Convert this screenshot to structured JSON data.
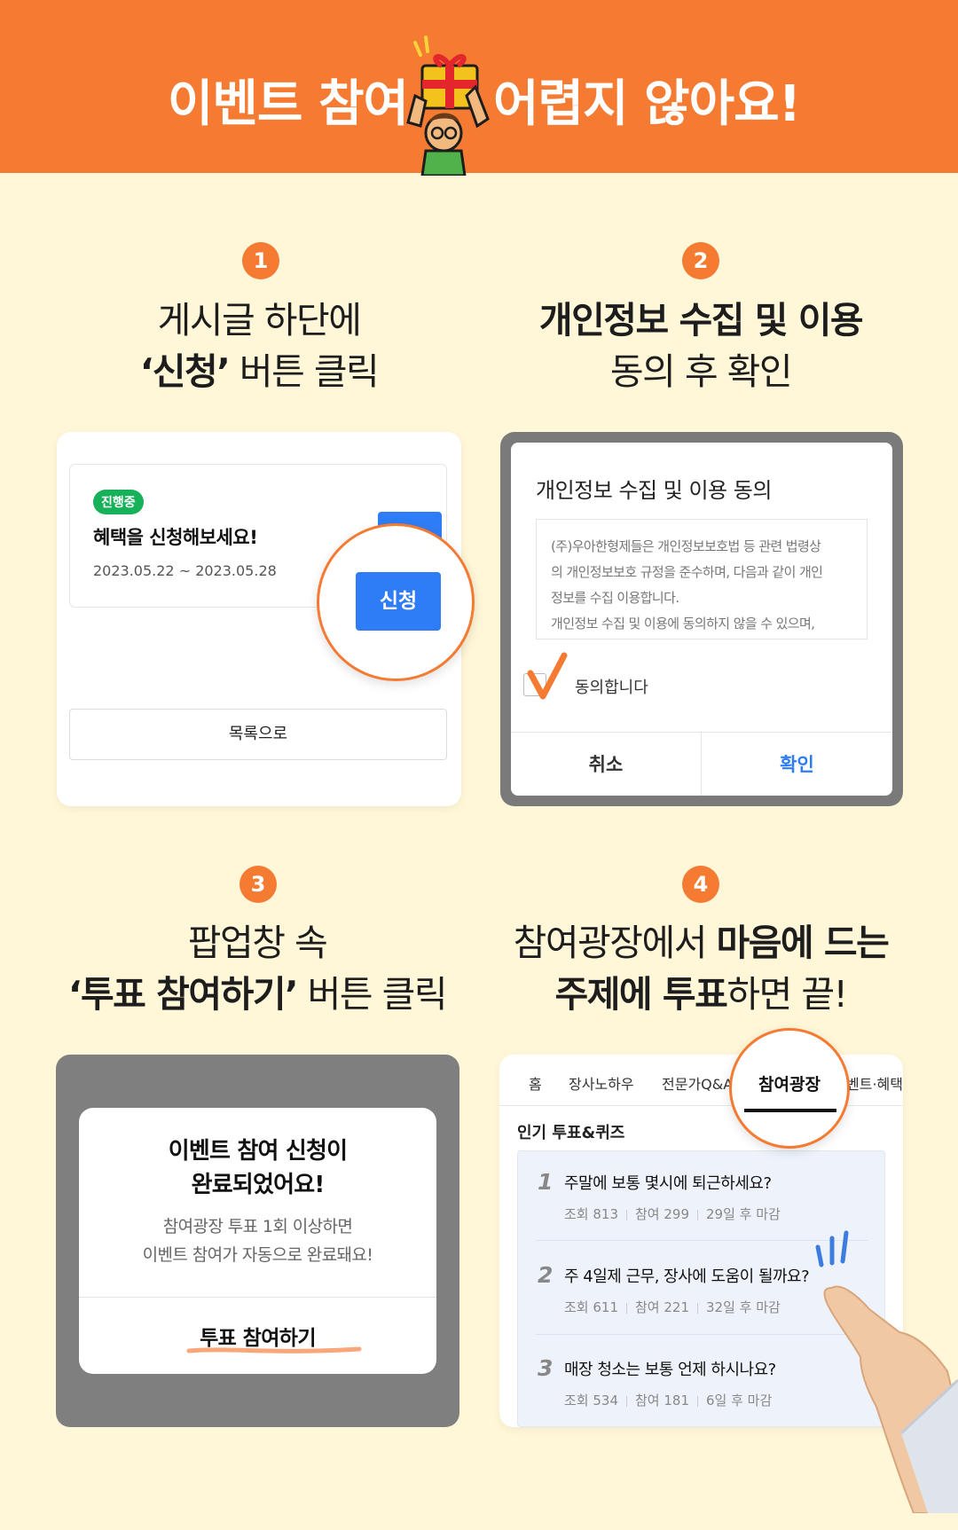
{
  "header": {
    "title_left": "이벤트 참여",
    "title_right": "어렵지 않아요!"
  },
  "steps": [
    {
      "number": "1",
      "line1": "게시글 하단에",
      "line2_bold": "‘신청’",
      "line2_rest": " 버튼 클릭"
    },
    {
      "number": "2",
      "line1_bold": "개인정보 수집 및 이용",
      "line2": "동의 후 확인"
    },
    {
      "number": "3",
      "line1": "팝업창 속",
      "line2_bold": "‘투표 참여하기’",
      "line2_rest": " 버튼 클릭"
    },
    {
      "number": "4",
      "line1_pre": "참여광장에서 ",
      "line1_bold": "마음에 드는",
      "line2_bold_a": "주제에 투표",
      "line2_rest": "하면 끝!"
    }
  ],
  "card1": {
    "status": "진행중",
    "title": "혜택을 신청해보세요!",
    "date": "2023.05.22 ~ 2023.05.28",
    "apply_label": "신청",
    "list_label": "목록으로"
  },
  "card2": {
    "title": "개인정보 수집 및 이용 동의",
    "terms": [
      "(주)우아한형제들은 개인정보보호법 등 관련 법령상",
      "의 개인정보보호 규정을 준수하며, 다음과 같이 개인",
      "정보를 수집 이용합니다.",
      "개인정보 수집 및 이용에 동의하지 않을 수 있으며,"
    ],
    "agree_label": "동의합니다",
    "cancel_label": "취소",
    "ok_label": "확인"
  },
  "card3": {
    "title_line1": "이벤트 참여 신청이",
    "title_line2": "완료되었어요!",
    "sub_line1": "참여광장 투표 1회 이상하면",
    "sub_line2": "이벤트 참여가 자동으로 완료돼요!",
    "button_label": "투표 참여하기"
  },
  "card4": {
    "nav": [
      "홈",
      "장사노하우",
      "전문가Q&A",
      "참여광장",
      "이벤트·혜택"
    ],
    "active_tab": "참여광장",
    "section_title": "인기 투표&퀴즈",
    "polls": [
      {
        "rank": "1",
        "question": "주말에 보통 몇시에 퇴근하세요?",
        "views": "조회 813",
        "participants": "참여 299",
        "deadline": "29일 후 마감"
      },
      {
        "rank": "2",
        "question": "주 4일제 근무, 장사에 도움이 될까요?",
        "views": "조회 611",
        "participants": "참여 221",
        "deadline": "32일 후 마감"
      },
      {
        "rank": "3",
        "question": "매장 청소는 보통 언제 하시나요?",
        "views": "조회 534",
        "participants": "참여 181",
        "deadline": "6일 후 마감"
      }
    ]
  },
  "colors": {
    "accent": "#f57a32",
    "background": "#fff7d8",
    "primary_blue": "#2f7df6",
    "status_green": "#17b15a"
  }
}
